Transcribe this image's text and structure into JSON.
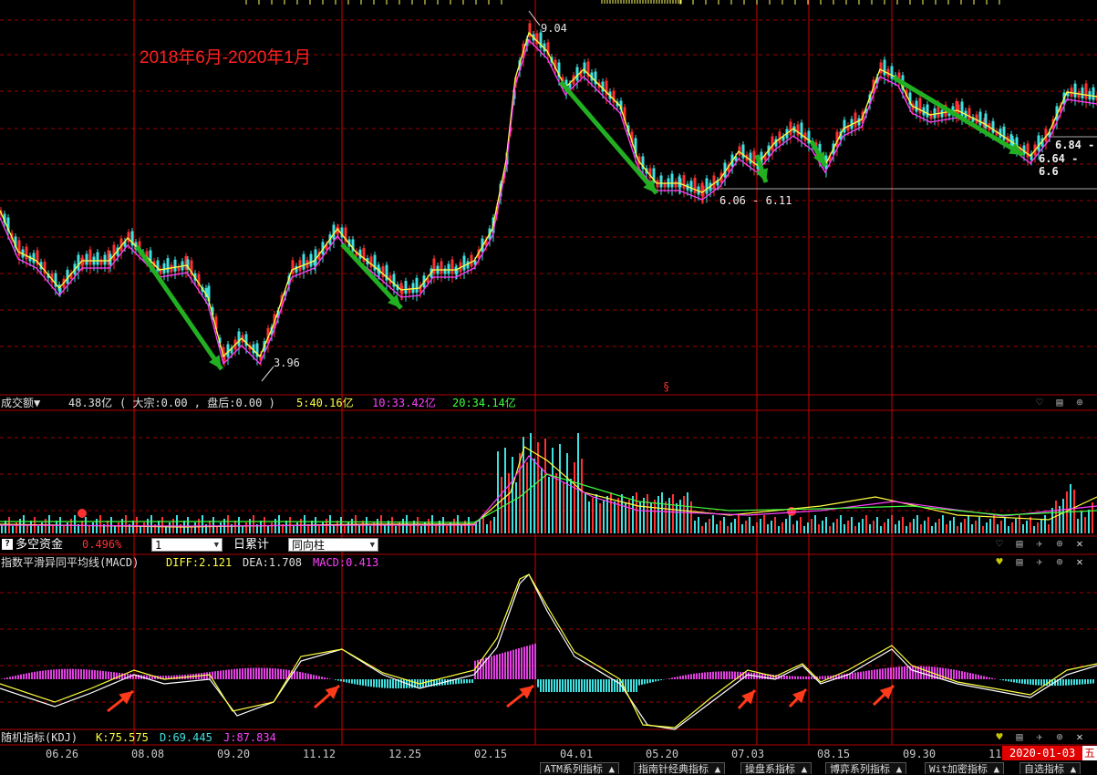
{
  "annotations": {
    "period_label": "2018年6月-2020年1月",
    "high_label": "9.04",
    "low_label": "3.96",
    "range_label_1": "6.06 - 6.11",
    "range_label_2a": "6.84 -",
    "range_label_2b": "6.64 - 6.6",
    "marker_symbol": "§"
  },
  "volume_panel": {
    "title": "成交额▼",
    "value": "48.38亿",
    "detail": "( 大宗:0.00 , 盘后:0.00 )",
    "ma5": "5:40.16亿",
    "ma10": "10:33.42亿",
    "ma20": "20:34.14亿"
  },
  "fund_bar": {
    "label": "多空资金",
    "value": "0.496%",
    "select1": "1",
    "mode": "日累计",
    "select2": "同向柱"
  },
  "macd_panel": {
    "title": "指数平滑异同平均线(MACD)",
    "diff": "DIFF:2.121",
    "dea": "DEA:1.708",
    "macd": "MACD:0.413"
  },
  "kdj_panel": {
    "title": "随机指标(KDJ)",
    "k": "K:75.575",
    "d": "D:69.445",
    "j": "J:87.834"
  },
  "x_axis": [
    "06.26",
    "08.08",
    "09.20",
    "11.12",
    "12.25",
    "02.15",
    "04.01",
    "05.20",
    "07.03",
    "08.15",
    "09.30",
    "11"
  ],
  "current_date": "2020-01-03",
  "current_weekday": "五",
  "bottom_tabs": [
    "ATM系列指标 ▲",
    "指南针经典指标 ▲",
    "操盘系指标 ▲",
    "博弈系列指标 ▲",
    "Wit加密指标 ▲",
    "自选指标 ▲"
  ],
  "colors": {
    "up": "#ff3030",
    "down": "#40e0e0",
    "ma5": "#ffff40",
    "ma10": "#ff40ff",
    "ma20": "#40ff40",
    "grid": "#a00000",
    "arrow_green": "#22b022",
    "arrow_red": "#ff3a1a"
  },
  "icons": {
    "help": "question-icon",
    "heart": "heart-icon",
    "save": "save-icon",
    "pin": "pin-icon",
    "zoom": "zoom-icon",
    "close": "close-icon"
  }
}
